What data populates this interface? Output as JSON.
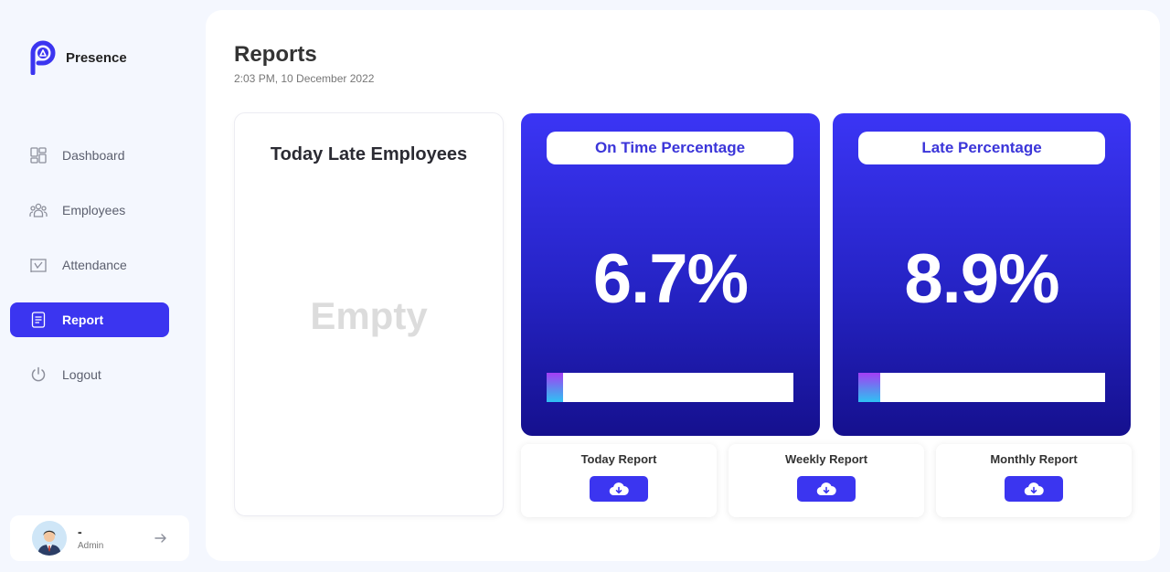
{
  "app": {
    "brand": "Presence"
  },
  "sidebar": {
    "items": [
      {
        "label": "Dashboard",
        "icon": "dashboard-icon"
      },
      {
        "label": "Employees",
        "icon": "employees-icon"
      },
      {
        "label": "Attendance",
        "icon": "attendance-icon"
      },
      {
        "label": "Report",
        "icon": "report-icon",
        "active": true
      },
      {
        "label": "Logout",
        "icon": "power-icon"
      }
    ]
  },
  "user": {
    "name": "-",
    "role": "Admin"
  },
  "header": {
    "title": "Reports",
    "datetime": "2:03 PM, 10 December 2022"
  },
  "late_card": {
    "title": "Today Late Employees",
    "empty_text": "Empty"
  },
  "stats": [
    {
      "label": "On Time Percentage",
      "value": "6.7%",
      "fraction": 0.067
    },
    {
      "label": "Late Percentage",
      "value": "8.9%",
      "fraction": 0.089
    }
  ],
  "reports": [
    {
      "label": "Today Report",
      "icon": "cloud-download-icon"
    },
    {
      "label": "Weekly Report",
      "icon": "cloud-download-icon"
    },
    {
      "label": "Monthly Report",
      "icon": "cloud-download-icon"
    }
  ],
  "colors": {
    "accent": "#3b35f0",
    "card_gradient_top": "#3b35f5",
    "card_gradient_bottom": "#15108e",
    "background": "#f4f7fe"
  }
}
